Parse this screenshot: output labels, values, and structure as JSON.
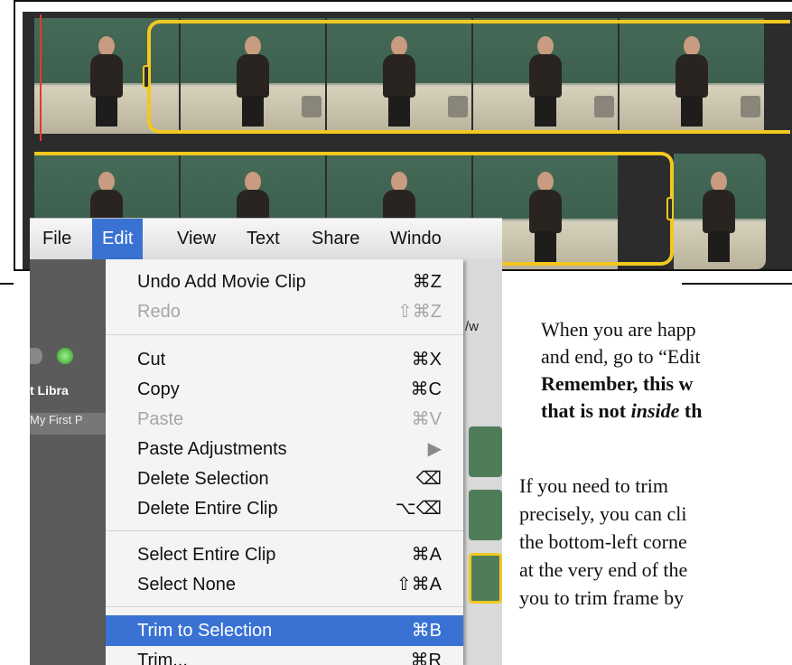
{
  "menubar": {
    "items": [
      {
        "label": "File",
        "active": false
      },
      {
        "label": "Edit",
        "active": true
      },
      {
        "label": "View",
        "active": false
      },
      {
        "label": "Text",
        "active": false
      },
      {
        "label": "Share",
        "active": false
      },
      {
        "label": "Windo",
        "active": false
      }
    ]
  },
  "background_app": {
    "library_label": "t Libra",
    "project_label": "My First P",
    "url_fragment": "/w"
  },
  "edit_menu": {
    "items": [
      {
        "label": "Undo Add Movie Clip",
        "shortcut": "⌘Z",
        "enabled": true
      },
      {
        "label": "Redo",
        "shortcut": "⇧⌘Z",
        "enabled": false
      },
      {
        "label": "Cut",
        "shortcut": "⌘X",
        "enabled": true
      },
      {
        "label": "Copy",
        "shortcut": "⌘C",
        "enabled": true
      },
      {
        "label": "Paste",
        "shortcut": "⌘V",
        "enabled": false
      },
      {
        "label": "Paste Adjustments",
        "shortcut": "▶",
        "enabled": true
      },
      {
        "label": "Delete Selection",
        "shortcut": "⌫",
        "enabled": true
      },
      {
        "label": "Delete Entire Clip",
        "shortcut": "⌥⌫",
        "enabled": true
      },
      {
        "label": "Select Entire Clip",
        "shortcut": "⌘A",
        "enabled": true
      },
      {
        "label": "Select None",
        "shortcut": "⇧⌘A",
        "enabled": true
      },
      {
        "label": "Trim to Selection",
        "shortcut": "⌘B",
        "enabled": true,
        "highlighted": true
      },
      {
        "label": "Trim...",
        "shortcut": "⌘R",
        "enabled": true
      }
    ]
  },
  "instructions": {
    "line1": "When you are happ",
    "line2": "and end, go to “Edit",
    "line3": "Remember, this w",
    "line4_a": "that is not ",
    "line4_b": "inside",
    "line4_c": " th",
    "para2_line1": "If you need to trim",
    "para2_line2": "precisely, you can cli",
    "para2_line3": "the bottom-left corne",
    "para2_line4": "at the very end of the",
    "para2_line5": "you to trim frame by"
  },
  "colors": {
    "selection": "#f2c81f",
    "menu_highlight": "#3a72d4",
    "playhead": "#e23b2e"
  }
}
